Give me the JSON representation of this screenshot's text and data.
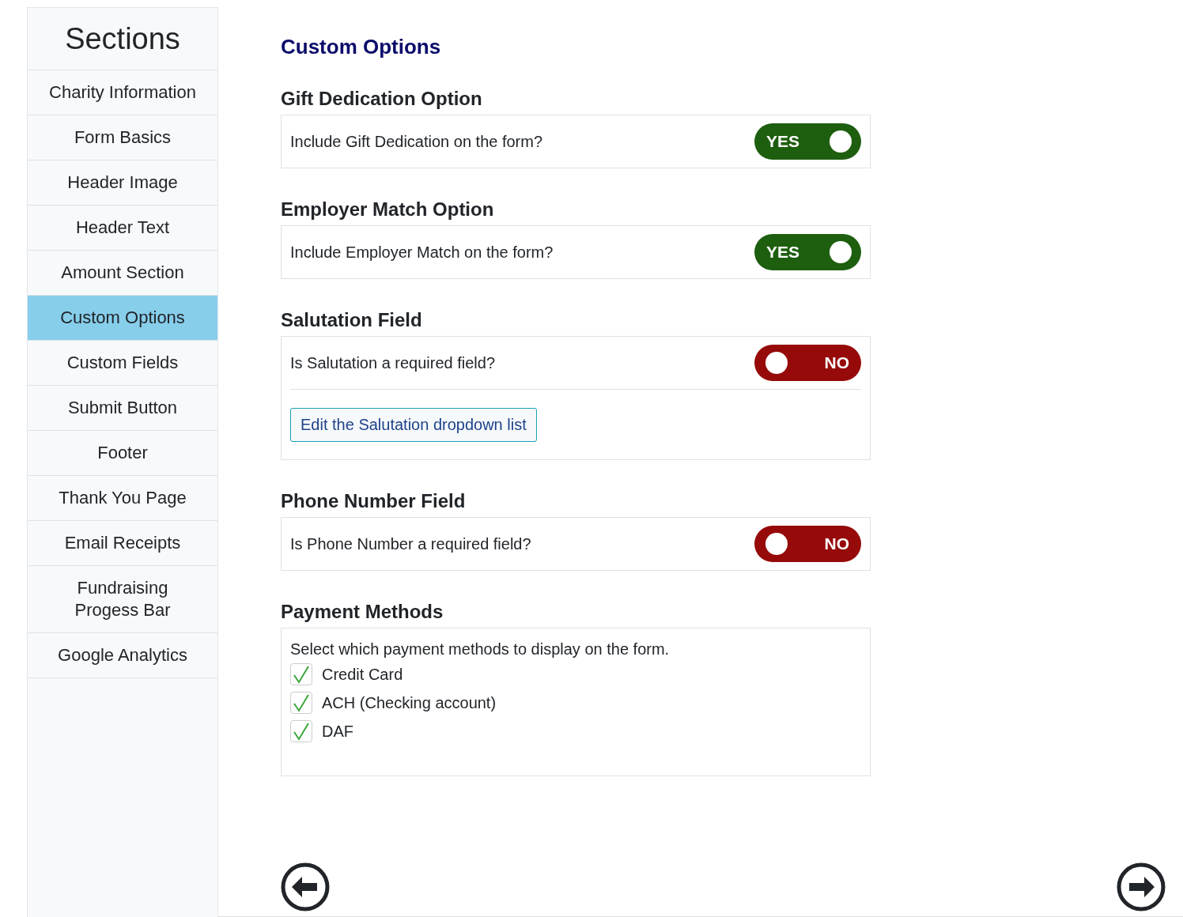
{
  "sidebar": {
    "title": "Sections",
    "items": [
      {
        "label": "Charity Information",
        "selected": false
      },
      {
        "label": "Form Basics",
        "selected": false
      },
      {
        "label": "Header Image",
        "selected": false
      },
      {
        "label": "Header Text",
        "selected": false
      },
      {
        "label": "Amount Section",
        "selected": false
      },
      {
        "label": "Custom Options",
        "selected": true
      },
      {
        "label": "Custom Fields",
        "selected": false
      },
      {
        "label": "Submit Button",
        "selected": false
      },
      {
        "label": "Footer",
        "selected": false
      },
      {
        "label": "Thank You Page",
        "selected": false
      },
      {
        "label": "Email Receipts",
        "selected": false
      },
      {
        "label": "Fundraising Progess Bar",
        "selected": false
      },
      {
        "label": "Google Analytics",
        "selected": false
      }
    ]
  },
  "page_title": "Custom Options",
  "sections": [
    {
      "kind": "toggle",
      "title": "Gift Dedication Option",
      "question": "Include Gift Dedication on the form?",
      "toggle": {
        "on": true,
        "label": "YES"
      }
    },
    {
      "kind": "toggle",
      "title": "Employer Match Option",
      "question": "Include Employer Match on the form?",
      "toggle": {
        "on": true,
        "label": "YES"
      }
    },
    {
      "kind": "toggle",
      "title": "Salutation Field",
      "question": "Is Salutation a required field?",
      "toggle": {
        "on": false,
        "label": "NO"
      },
      "button": "Edit the Salutation dropdown list"
    },
    {
      "kind": "toggle",
      "title": "Phone Number Field",
      "question": "Is Phone Number a required field?",
      "toggle": {
        "on": false,
        "label": "NO"
      }
    },
    {
      "kind": "checklist",
      "title": "Payment Methods",
      "intro": "Select which payment methods to display on the form.",
      "options": [
        {
          "label": "Credit Card",
          "checked": true
        },
        {
          "label": "ACH (Checking account)",
          "checked": true
        },
        {
          "label": "DAF",
          "checked": true
        }
      ]
    }
  ]
}
